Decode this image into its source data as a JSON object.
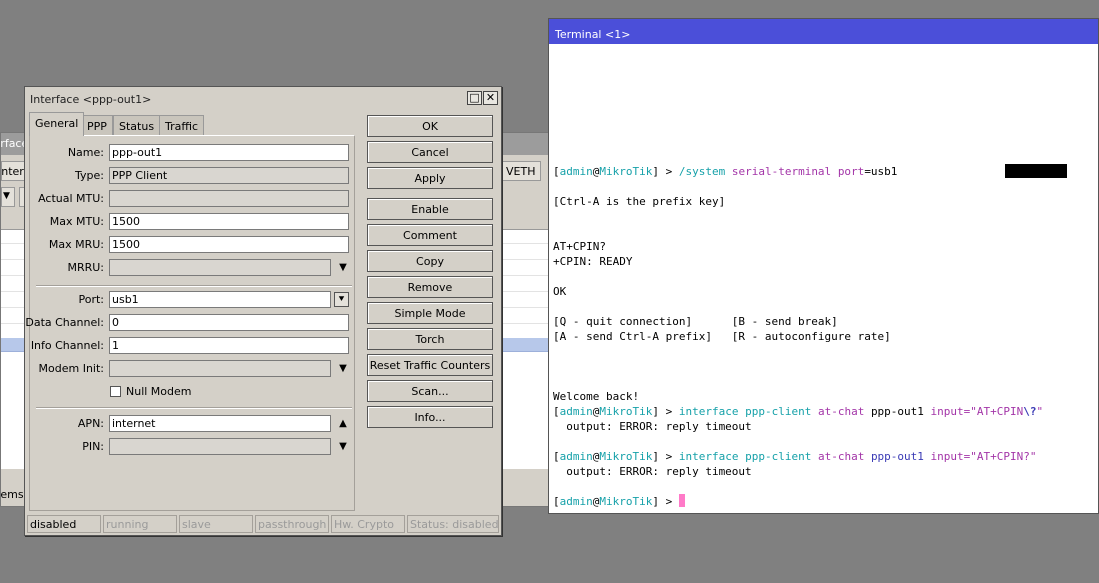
{
  "background_window": {
    "title": "Interface",
    "tab_label": "Interfa",
    "veth_tab": "VETH",
    "footer": "items"
  },
  "dialog": {
    "title": "Interface <ppp-out1>",
    "tabs": [
      "General",
      "PPP",
      "Status",
      "Traffic"
    ],
    "fields": {
      "name": {
        "label": "Name:",
        "value": "ppp-out1"
      },
      "type": {
        "label": "Type:",
        "value": "PPP Client"
      },
      "actual_mtu": {
        "label": "Actual MTU:",
        "value": ""
      },
      "max_mtu": {
        "label": "Max MTU:",
        "value": "1500"
      },
      "max_mru": {
        "label": "Max MRU:",
        "value": "1500"
      },
      "mrru": {
        "label": "MRRU:",
        "value": ""
      },
      "port": {
        "label": "Port:",
        "value": "usb1"
      },
      "data_channel": {
        "label": "Data Channel:",
        "value": "0"
      },
      "info_channel": {
        "label": "Info Channel:",
        "value": "1"
      },
      "modem_init": {
        "label": "Modem Init:",
        "value": ""
      },
      "null_modem": {
        "label": "Null Modem",
        "checked": false
      },
      "apn": {
        "label": "APN:",
        "value": "internet"
      },
      "pin": {
        "label": "PIN:",
        "value": ""
      }
    },
    "buttons": [
      "OK",
      "Cancel",
      "Apply",
      "Enable",
      "Comment",
      "Copy",
      "Remove",
      "Simple Mode",
      "Torch",
      "Reset Traffic Counters",
      "Scan...",
      "Info..."
    ],
    "status_bar": [
      "disabled",
      "running",
      "slave",
      "passthrough",
      "Hw. Crypto",
      "Status: disabled"
    ]
  },
  "terminal": {
    "title": "Terminal <1>",
    "prompt_open": "[",
    "prompt_user": "admin",
    "prompt_at": "@",
    "prompt_host": "MikroTik",
    "prompt_close": "] > ",
    "line1_cmd": "/system",
    "line1_sub": "serial-terminal",
    "line1_arg": "port",
    "line1_val": "=usb1",
    "prefix_line": "[Ctrl-A is the prefix key]",
    "at_cpin": "AT+CPIN?",
    "cpin_ready": "+CPIN: READY",
    "ok": "OK",
    "help1": "[Q - quit connection]      [B - send break]",
    "help2": "[A - send Ctrl-A prefix]   [R - autoconfigure rate]",
    "welcome": "Welcome back!",
    "cmd_iface": "interface",
    "cmd_ppp": "ppp-client",
    "cmd_atchat": "at-chat",
    "cmd_target": "ppp-out1",
    "cmd_input": "input",
    "cmd1_str_a": "=\"AT+CPIN",
    "cmd1_esc": "\\?",
    "cmd1_str_b": "\"",
    "cmd2_str": "=\"AT+CPIN?\"",
    "output": "  output: ERROR: reply timeout"
  }
}
